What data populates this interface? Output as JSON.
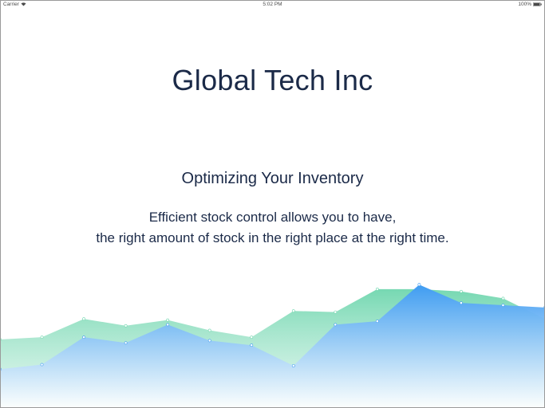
{
  "status_bar": {
    "carrier": "Carrier",
    "time": "5:02 PM",
    "battery": "100%"
  },
  "company": {
    "name": "Global Tech Inc"
  },
  "headline": {
    "tagline": "Optimizing Your Inventory",
    "description_line1": "Efficient stock control allows you to have,",
    "description_line2": "the right amount of stock in the right place at the right time."
  },
  "chart_data": {
    "type": "area",
    "series": [
      {
        "color": "#6fd6ae",
        "values": [
          60,
          62,
          78,
          72,
          77,
          68,
          62,
          85,
          84,
          104,
          104,
          102,
          96,
          78
        ]
      },
      {
        "color": "#3f9cf2",
        "values": [
          34,
          38,
          62,
          57,
          73,
          59,
          55,
          37,
          73,
          76,
          108,
          92,
          90,
          88
        ]
      }
    ]
  }
}
